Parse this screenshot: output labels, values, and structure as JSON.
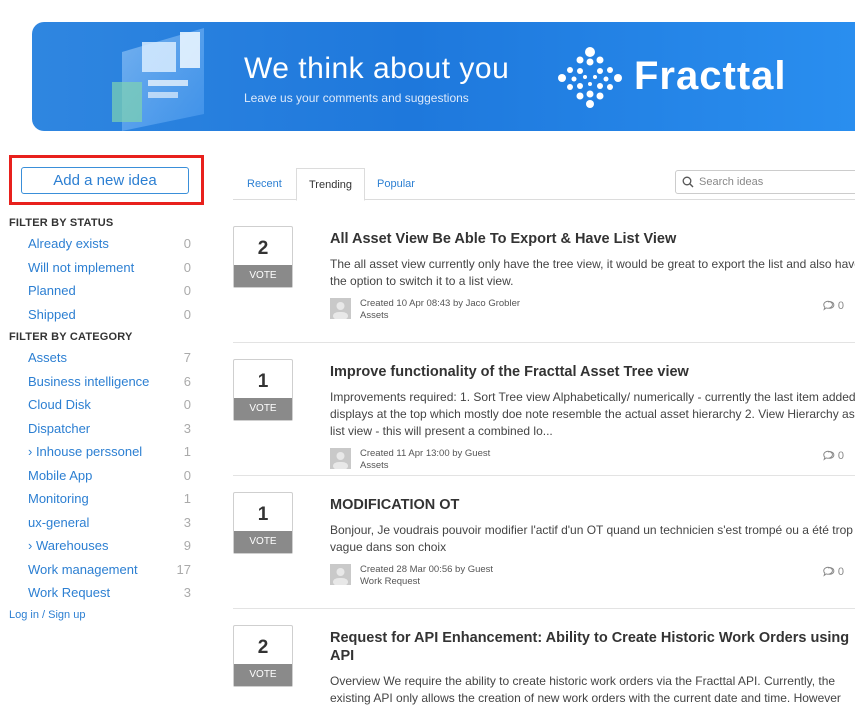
{
  "banner": {
    "title": "We think about you",
    "subtitle": "Leave us your comments and suggestions",
    "brand": "Fracttal"
  },
  "sidebar": {
    "add_idea": "Add a new idea",
    "status_heading": "FILTER BY STATUS",
    "status": [
      {
        "label": "Already exists",
        "count": "0"
      },
      {
        "label": "Will not implement",
        "count": "0"
      },
      {
        "label": "Planned",
        "count": "0"
      },
      {
        "label": "Shipped",
        "count": "0"
      }
    ],
    "category_heading": "FILTER BY CATEGORY",
    "categories": [
      {
        "label": "Assets",
        "count": "7"
      },
      {
        "label": "Business intelligence",
        "count": "6"
      },
      {
        "label": "Cloud Disk",
        "count": "0"
      },
      {
        "label": "Dispatcher",
        "count": "3"
      },
      {
        "label": "› Inhouse perssonel",
        "count": "1"
      },
      {
        "label": "Mobile App",
        "count": "0"
      },
      {
        "label": "Monitoring",
        "count": "1"
      },
      {
        "label": "ux-general",
        "count": "3"
      },
      {
        "label": "› Warehouses",
        "count": "9"
      },
      {
        "label": "Work management",
        "count": "17"
      },
      {
        "label": "Work Request",
        "count": "3"
      }
    ],
    "login": "Log in / Sign up"
  },
  "tabs": {
    "recent": "Recent",
    "trending": "Trending",
    "popular": "Popular",
    "search_placeholder": "Search ideas"
  },
  "ideas": [
    {
      "votes": "2",
      "vote_label": "VOTE",
      "title": "All Asset View Be Able To Export & Have List View",
      "description": "The all asset view currently only have the tree view, it would be great to export the list and also have the option to switch it to a list view.",
      "created": "Created 10 Apr 08:43 by Jaco Grobler",
      "category": "Assets",
      "comments": "0"
    },
    {
      "votes": "1",
      "vote_label": "VOTE",
      "title": "Improve functionality of the Fracttal Asset Tree view",
      "description": "Improvements required: 1. Sort Tree view Alphabetically/ numerically - currently the last item added displays at the top which mostly doe note resemble the actual asset hierarchy 2. View Hierarchy as a list view - this will present a combined lo...",
      "created": "Created 11 Apr 13:00 by Guest",
      "category": "Assets",
      "comments": "0"
    },
    {
      "votes": "1",
      "vote_label": "VOTE",
      "title": "MODIFICATION OT",
      "description": "Bonjour, Je voudrais pouvoir modifier l'actif d'un OT quand un technicien s'est trompé ou a été trop vague dans son choix",
      "created": "Created 28 Mar 00:56 by Guest",
      "category": "Work Request",
      "comments": "0"
    },
    {
      "votes": "2",
      "vote_label": "VOTE",
      "title": "Request for API Enhancement: Ability to Create Historic Work Orders using API",
      "description": "Overview We require the ability to create historic work orders via the Fracttal API. Currently, the existing API only allows the creation of new work orders with the current date and time. However"
    }
  ]
}
